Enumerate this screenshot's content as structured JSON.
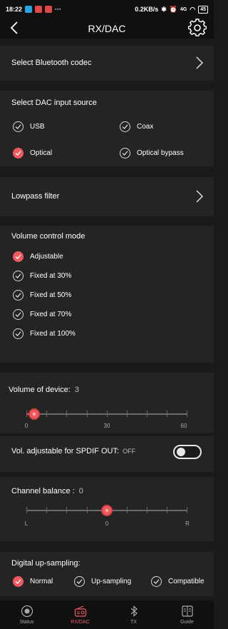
{
  "status": {
    "time": "18:22",
    "dots": "···",
    "net_speed": "0.2KB/s",
    "network": "4G",
    "battery": "45"
  },
  "header": {
    "title": "RX/DAC"
  },
  "bluetooth_codec": {
    "label": "Select Bluetooth codec"
  },
  "dac_source": {
    "label": "Select DAC input source",
    "options": [
      {
        "label": "USB",
        "selected": false
      },
      {
        "label": "Coax",
        "selected": false
      },
      {
        "label": "Optical",
        "selected": true
      },
      {
        "label": "Optical bypass",
        "selected": false
      }
    ]
  },
  "lowpass": {
    "label": "Lowpass filter"
  },
  "volume_mode": {
    "label": "Volume control mode",
    "options": [
      {
        "label": "Adjustable",
        "selected": true
      },
      {
        "label": "Fixed at 30%",
        "selected": false
      },
      {
        "label": "Fixed at 50%",
        "selected": false
      },
      {
        "label": "Fixed at 70%",
        "selected": false
      },
      {
        "label": "Fixed at 100%",
        "selected": false
      }
    ]
  },
  "volume_device": {
    "label": "Volume of device:",
    "value": "3",
    "min_label": "0",
    "mid_label": "30",
    "max_label": "60",
    "fraction": 0.05
  },
  "spdif": {
    "label": "Vol. adjustable for SPDIF OUT:",
    "state": "OFF",
    "on": false
  },
  "balance": {
    "label": "Channel balance :",
    "value": "0",
    "left_label": "L",
    "center_label": "0",
    "right_label": "R",
    "fraction": 0.5
  },
  "upsampling": {
    "label": "Digital up-sampling:",
    "options": [
      {
        "label": "Normal",
        "selected": true
      },
      {
        "label": "Up-sampling",
        "selected": false
      },
      {
        "label": "Compatible",
        "selected": false
      }
    ]
  },
  "nav": {
    "items": [
      {
        "label": "Status",
        "icon": "status-icon",
        "active": false
      },
      {
        "label": "RX/DAC",
        "icon": "radio-icon",
        "active": true
      },
      {
        "label": "TX",
        "icon": "bluetooth-icon",
        "active": false
      },
      {
        "label": "Guide",
        "icon": "guide-icon",
        "active": false
      }
    ]
  },
  "colors": {
    "accent": "#f05a5f",
    "panel": "#242424",
    "background": "#1a1a1a"
  }
}
